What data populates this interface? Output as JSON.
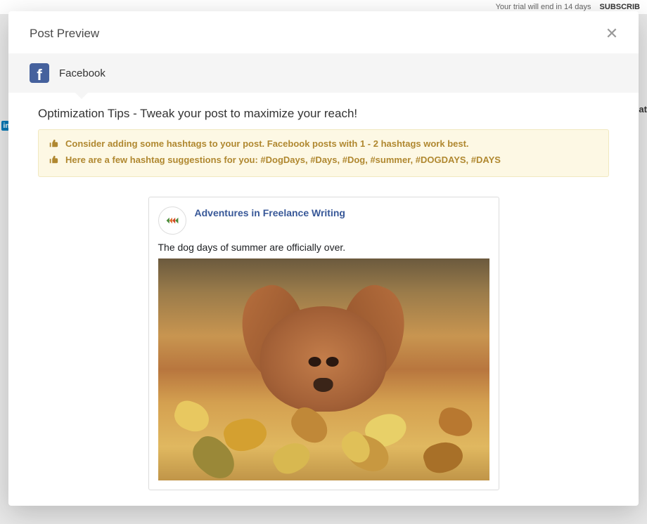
{
  "background": {
    "trial_text": "Your trial will end in 14 days",
    "subscribe": "SUBSCRIB",
    "side_text": "Cat"
  },
  "modal": {
    "title": "Post Preview"
  },
  "platform": {
    "name": "Facebook",
    "icon_letter": "f"
  },
  "optimization": {
    "heading": "Optimization Tips - Tweak your post to maximize your reach!",
    "tips": [
      "Consider adding some hashtags to your post. Facebook posts with 1 - 2 hashtags work best.",
      "Here are a few hashtag suggestions for you: #DogDays, #Days, #Dog, #summer, #DOGDAYS, #DAYS"
    ]
  },
  "post": {
    "page_name": "Adventures in Freelance Writing",
    "text": "The dog days of summer are officially over.",
    "image_alt": "dog-in-autumn-leaves"
  }
}
